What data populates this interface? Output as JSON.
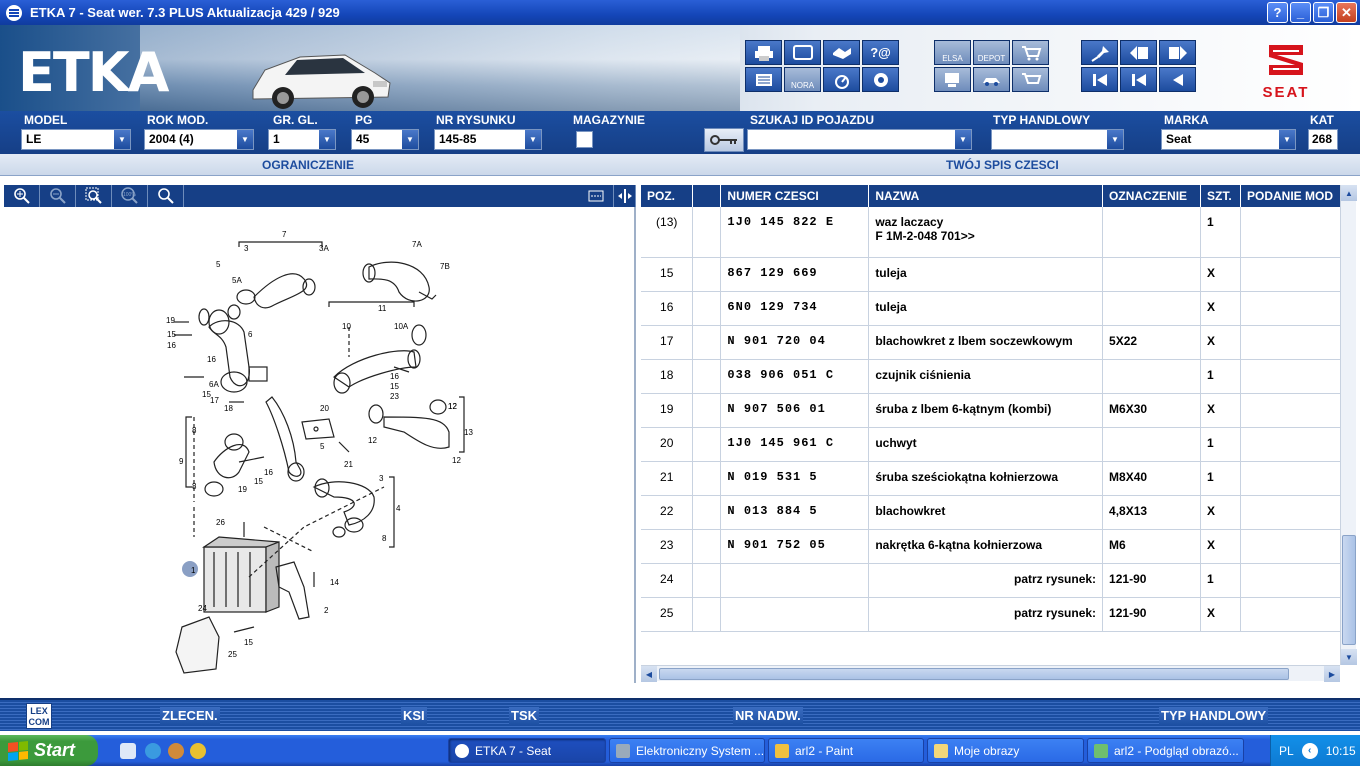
{
  "window": {
    "title": "ETKA 7 - Seat wer. 7.3 PLUS Aktualizacja 429 / 929",
    "buttons": [
      "?",
      "_",
      "❐",
      "✕"
    ]
  },
  "header": {
    "logo": "ETKA",
    "brand_word": "SEAT"
  },
  "toolbar_labels": {
    "elsa": "ELSA",
    "depot": "DEPOT",
    "nora": "NORA"
  },
  "filters": {
    "model": {
      "label": "MODEL",
      "value": "LE"
    },
    "rok_mod": {
      "label": "ROK MOD.",
      "value": "2004 (4)"
    },
    "gr_gl": {
      "label": "GR. GL.",
      "value": "1"
    },
    "pg": {
      "label": "PG",
      "value": "45"
    },
    "nr_rysunku": {
      "label": "NR RYSUNKU",
      "value": "145-85"
    },
    "magazynie": {
      "label": "MAGAZYNIE"
    },
    "szukaj_id": {
      "label": "SZUKAJ ID POJAZDU",
      "value": ""
    },
    "typ_handlowy": {
      "label": "TYP HANDLOWY",
      "value": ""
    },
    "marka": {
      "label": "MARKA",
      "value": "Seat"
    },
    "kat": {
      "label": "KAT",
      "value": "268"
    }
  },
  "subbar": {
    "left": "OGRANICZENIE",
    "right": "TWÓJ SPIS CZESCI"
  },
  "table": {
    "columns": [
      "POZ.",
      "",
      "NUMER CZESCI",
      "NAZWA",
      "OZNACZENIE",
      "SZT.",
      "PODANIE MOD"
    ],
    "rows": [
      {
        "poz": "(13)",
        "numer": "1J0  145  822  E",
        "nazwa": "waz laczacy",
        "nazwa2": "F 1M-2-048 701>>",
        "ozn": "",
        "szt": "1"
      },
      {
        "poz": "15",
        "numer": "867  129  669",
        "nazwa": "tuleja",
        "ozn": "",
        "szt": "X"
      },
      {
        "poz": "16",
        "numer": "6N0  129  734",
        "nazwa": "tuleja",
        "ozn": "",
        "szt": "X"
      },
      {
        "poz": "17",
        "numer": "N    901  720  04",
        "nazwa": "blachowkret z lbem soczewkowym",
        "ozn": "5X22",
        "szt": "X"
      },
      {
        "poz": "18",
        "numer": "038  906  051  C",
        "nazwa": "czujnik ciśnienia",
        "ozn": "",
        "szt": "1"
      },
      {
        "poz": "19",
        "numer": "N    907  506  01",
        "nazwa": "śruba z lbem 6-kątnym (kombi)",
        "ozn": "M6X30",
        "szt": "X"
      },
      {
        "poz": "20",
        "numer": "1J0  145  961  C",
        "nazwa": "uchwyt",
        "ozn": "",
        "szt": "1"
      },
      {
        "poz": "21",
        "numer": "N    019  531  5",
        "nazwa": "śruba sześciokątna kołnierzowa",
        "ozn": "M8X40",
        "szt": "1"
      },
      {
        "poz": "22",
        "numer": "N    013  884  5",
        "nazwa": "blachowkret",
        "ozn": "4,8X13",
        "szt": "X"
      },
      {
        "poz": "23",
        "numer": "N    901  752  05",
        "nazwa": "nakrętka 6-kątna kołnierzowa",
        "ozn": "M6",
        "szt": "X"
      },
      {
        "poz": "24",
        "numer": "",
        "nazwa": "patrz rysunek:",
        "ozn": "121-90",
        "szt": "1",
        "ref": true
      },
      {
        "poz": "25",
        "numer": "",
        "nazwa": "patrz rysunek:",
        "ozn": "121-90",
        "szt": "X",
        "ref": true
      }
    ]
  },
  "bottom": {
    "lexcom1": "LEX",
    "lexcom2": "COM",
    "zlecen": "ZLECEN.",
    "ksi": "KSI",
    "tsk": "TSK",
    "nr_nadw": "NR NADW.",
    "typ_handlowy": "TYP HANDLOWY"
  },
  "taskbar": {
    "start": "Start",
    "tasks": [
      "ETKA 7 - Seat",
      "Elektroniczny System ...",
      "arl2 - Paint",
      "Moje obrazy",
      "arl2 - Podgląd obrazó..."
    ],
    "lang": "PL",
    "clock": "10:15"
  },
  "diagram_labels": [
    "7",
    "3",
    "3A",
    "5",
    "5A",
    "7A",
    "7B",
    "19",
    "15",
    "16",
    "6",
    "16",
    "6A",
    "15",
    "17",
    "18",
    "10",
    "11",
    "10A",
    "16",
    "15",
    "23",
    "12",
    "12",
    "13",
    "12",
    "8",
    "20",
    "5",
    "12",
    "21",
    "9",
    "19",
    "15",
    "16",
    "8",
    "3",
    "4",
    "26",
    "1",
    "8",
    "14",
    "2",
    "24",
    "15",
    "25"
  ]
}
